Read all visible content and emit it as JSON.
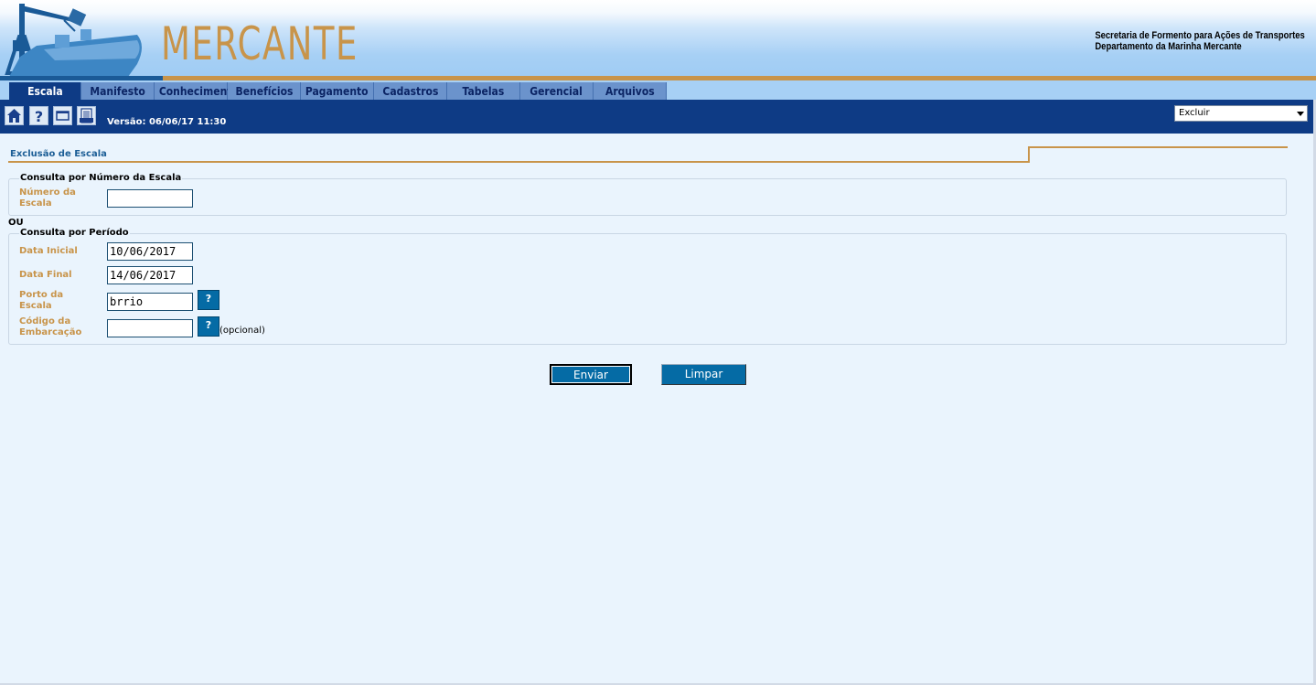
{
  "header": {
    "brand": "MERCANTE",
    "ministry_line1": "Secretaria de Formento para Ações de Transportes",
    "ministry_line2": "Departamento da Marinha Mercante"
  },
  "tabs": [
    {
      "label": "Escala",
      "active": true
    },
    {
      "label": "Manifesto",
      "active": false
    },
    {
      "label": "Conhecimento",
      "active": false
    },
    {
      "label": "Benefícios",
      "active": false
    },
    {
      "label": "Pagamento",
      "active": false
    },
    {
      "label": "Cadastros",
      "active": false
    },
    {
      "label": "Tabelas",
      "active": false
    },
    {
      "label": "Gerencial",
      "active": false
    },
    {
      "label": "Arquivos",
      "active": false
    }
  ],
  "toolbar": {
    "icons": [
      "home-icon",
      "help-icon",
      "window-icon",
      "print-icon"
    ],
    "version": "Versão: 06/06/17 11:30",
    "action_select_value": "Excluir"
  },
  "page": {
    "title": "Exclusão de Escala",
    "or_label": "OU",
    "optional_label": "(opcional)"
  },
  "consulta_numero": {
    "legend": "Consulta por Número da Escala",
    "numero_label_1": "Número da",
    "numero_label_2": "Escala",
    "numero_value": ""
  },
  "consulta_periodo": {
    "legend": "Consulta por Período",
    "data_inicial_label": "Data Inicial",
    "data_inicial_value": "10/06/2017",
    "data_final_label": "Data Final",
    "data_final_value": "14/06/2017",
    "porto_label_1": "Porto da",
    "porto_label_2": "Escala",
    "porto_value": "brrio",
    "codigo_label_1": "Código da",
    "codigo_label_2": "Embarcação",
    "codigo_value": "",
    "lookup_label": "?"
  },
  "buttons": {
    "enviar": "Enviar",
    "limpar": "Limpar"
  },
  "colors": {
    "navy": "#0e3b85",
    "gold": "#c8944a",
    "button_blue": "#056ba5",
    "page_bg": "#eaf4fd"
  }
}
